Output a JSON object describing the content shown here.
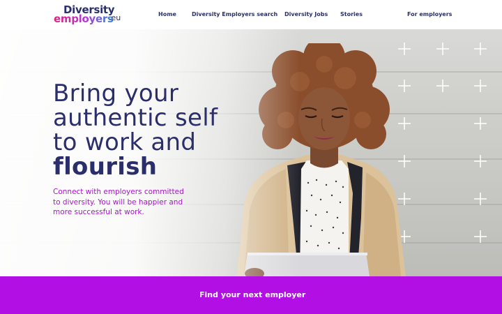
{
  "header": {
    "logo": {
      "line1": "Diversity",
      "line2": "employers",
      "tld": ".eu"
    },
    "nav": [
      {
        "label": "Home"
      },
      {
        "label": "Diversity Employers search"
      },
      {
        "label": "Diversity Jobs"
      },
      {
        "label": "Stories"
      },
      {
        "label": "For employers"
      }
    ]
  },
  "hero": {
    "headline": [
      "Bring your",
      "authentic self",
      "to work and",
      "flourish"
    ],
    "subtext": "Connect with employers committed to diversity. You will be happier and more successful at work.",
    "image_description_icon": "woman-with-laptop-photo"
  },
  "cta": {
    "label": "Find your next employer",
    "chevron": "›"
  },
  "colors": {
    "navy": "#2a2f6b",
    "purple": "#b10fe3",
    "subtext": "#a516c9",
    "logo_pink": "#e0207f"
  }
}
